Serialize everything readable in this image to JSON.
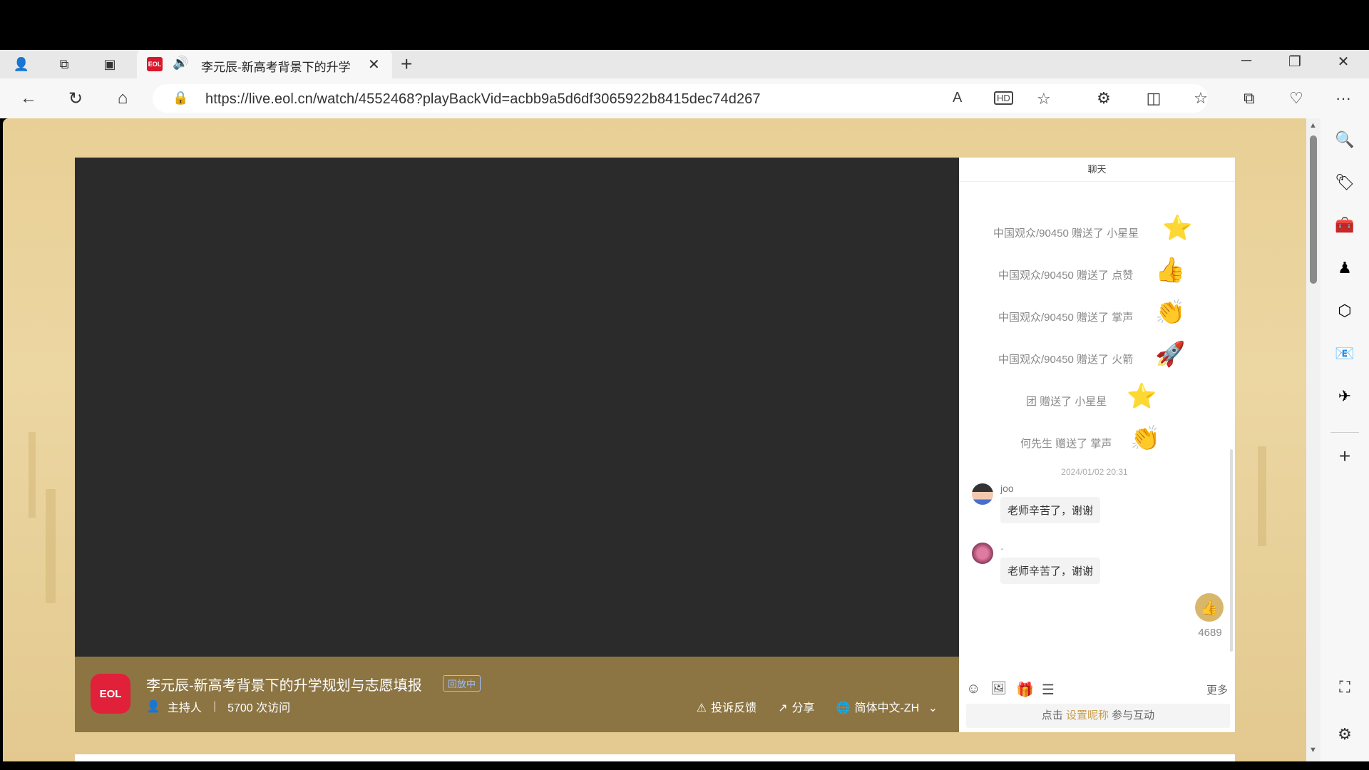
{
  "browser": {
    "tab_title": "李元辰-新高考背景下的升学",
    "tab_favicon_text": "EOL",
    "url": "https://live.eol.cn/watch/4552468?playBackVid=acbb9a5d6df3065922b8415dec74d267",
    "icons": {
      "profile": "👤",
      "collections": "⧉",
      "tabs": "▣",
      "audio": "🔊",
      "close": "✕",
      "new_tab": "+",
      "minimize": "─",
      "restore": "❐",
      "window_close": "✕",
      "back": "←",
      "refresh": "↻",
      "home": "⌂",
      "lock": "🔒",
      "read_aloud": "A",
      "hd": "HD",
      "favorite": "☆",
      "extensions": "⚙",
      "split": "◫",
      "favorites_list": "☆",
      "collections2": "⧉",
      "health": "♡",
      "more": "···"
    }
  },
  "video": {
    "title": "李元辰-新高考背景下的升学规划与志愿填报",
    "badge": "回放中",
    "logo_text": "EOL",
    "host_label": "主持人",
    "visits": "5700 次访问",
    "actions": [
      {
        "icon": "⚠",
        "label": "投诉反馈"
      },
      {
        "icon": "↗",
        "label": "分享"
      },
      {
        "icon": "🌐",
        "label": "简体中文-ZH"
      }
    ],
    "lang_chevron": "⌄"
  },
  "chat": {
    "header": "聊天",
    "gifts": [
      {
        "text": "中国观众/90450 赠送了 小星星",
        "emoji": "⭐"
      },
      {
        "text": "中国观众/90450 赠送了 点赞",
        "emoji": "👍"
      },
      {
        "text": "中国观众/90450 赠送了 掌声",
        "emoji": "👏"
      },
      {
        "text": "中国观众/90450 赠送了 火箭",
        "emoji": "🚀"
      },
      {
        "text": "团 赠送了 小星星",
        "emoji": "⭐"
      },
      {
        "text": "何先生 赠送了 掌声",
        "emoji": "👏"
      }
    ],
    "timestamp": "2024/01/02 20:31",
    "messages": [
      {
        "user": "joo",
        "text": "老师辛苦了，谢谢"
      },
      {
        "user": "·",
        "text": "老师辛苦了，谢谢"
      }
    ],
    "like_count": "4689",
    "like_icon": "👍",
    "tools": {
      "emoji": "☺",
      "image": "🖼",
      "gift": "🎁",
      "notes": "☰"
    },
    "more": "更多",
    "join_prefix": "点击",
    "join_highlight": "设置昵称",
    "join_suffix": "参与互动"
  },
  "sidebar": {
    "icons": [
      "🔍",
      "🏷",
      "🧰",
      "♟",
      "⬡",
      "📧",
      "✈"
    ],
    "add": "+",
    "screenshot": "⛶",
    "settings": "⚙"
  }
}
